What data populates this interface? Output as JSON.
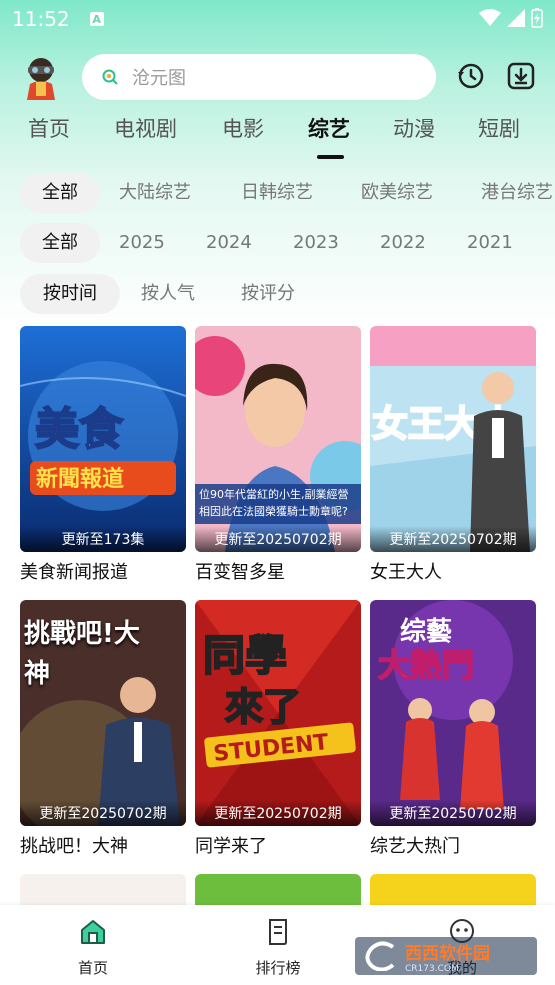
{
  "status_bar": {
    "time": "11:52",
    "notif_letter": "A"
  },
  "search": {
    "placeholder": "沧元图"
  },
  "main_tabs": [
    "首页",
    "电视剧",
    "电影",
    "综艺",
    "动漫",
    "短剧"
  ],
  "region_filters": [
    "全部",
    "大陆综艺",
    "日韩综艺",
    "欧美综艺",
    "港台综艺"
  ],
  "year_filters": [
    "全部",
    "2025",
    "2024",
    "2023",
    "2022",
    "2021"
  ],
  "sort_filters": [
    "按时间",
    "按人气",
    "按评分"
  ],
  "cards": [
    {
      "title": "美食新闻报道",
      "update": "更新至173集"
    },
    {
      "title": "百变智多星",
      "update": "更新至20250702期"
    },
    {
      "title": "女王大人",
      "update": "更新至20250702期"
    },
    {
      "title": "挑战吧！大神",
      "update": "更新至20250702期"
    },
    {
      "title": "同学来了",
      "update": "更新至20250702期"
    },
    {
      "title": "综艺大热门",
      "update": "更新至20250702期"
    }
  ],
  "poster_text": {
    "c0_line1": "美食",
    "c0_line2": "新聞報道",
    "c1_caption": "位90年代當紅的小生,副業經營相因此在法國榮獲騎士勳章呢?",
    "c2_text": "女王大人",
    "c3_text": "挑戰吧!大神",
    "c4_line1": "同學",
    "c4_line2": "來了",
    "c4_line3": "STUDENT",
    "c5_line1": "综藝",
    "c5_line2": "大熱門"
  },
  "bottom_nav": [
    {
      "label": "首页",
      "icon": "home-icon"
    },
    {
      "label": "排行榜",
      "icon": "ranking-icon"
    },
    {
      "label": "我的",
      "icon": "profile-icon"
    }
  ],
  "watermark": {
    "text": "西西软件园",
    "site": "CR173.COM"
  },
  "colors": {
    "accent": "#7fe8c9",
    "active_chip_bg": "#f1f1f1"
  }
}
